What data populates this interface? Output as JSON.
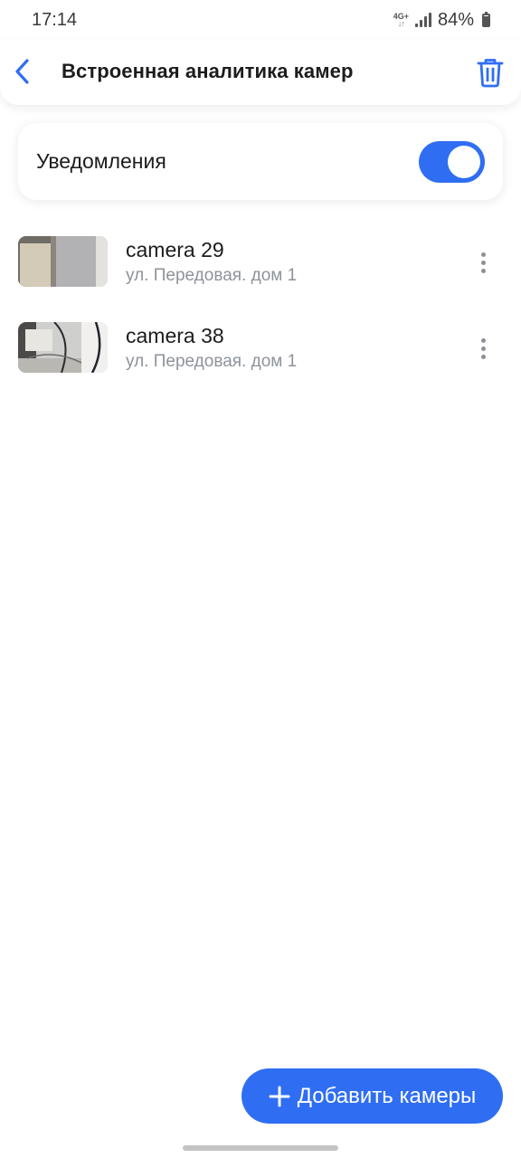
{
  "status_bar": {
    "time": "17:14",
    "network_type": "4G+",
    "battery": "84%"
  },
  "header": {
    "title": "Встроенная аналитика камер",
    "back_icon": "chevron-left-icon",
    "delete_icon": "trash-icon"
  },
  "notifications": {
    "label": "Уведомления",
    "enabled": true
  },
  "cameras": [
    {
      "name": "camera 29",
      "address": "ул. Передовая. дом 1"
    },
    {
      "name": "camera 38",
      "address": "ул. Передовая. дом 1"
    }
  ],
  "add_button": {
    "label": "Добавить камеры",
    "icon": "plus-icon"
  },
  "colors": {
    "accent": "#2f6ef3",
    "secondary_text": "#8e939b"
  }
}
